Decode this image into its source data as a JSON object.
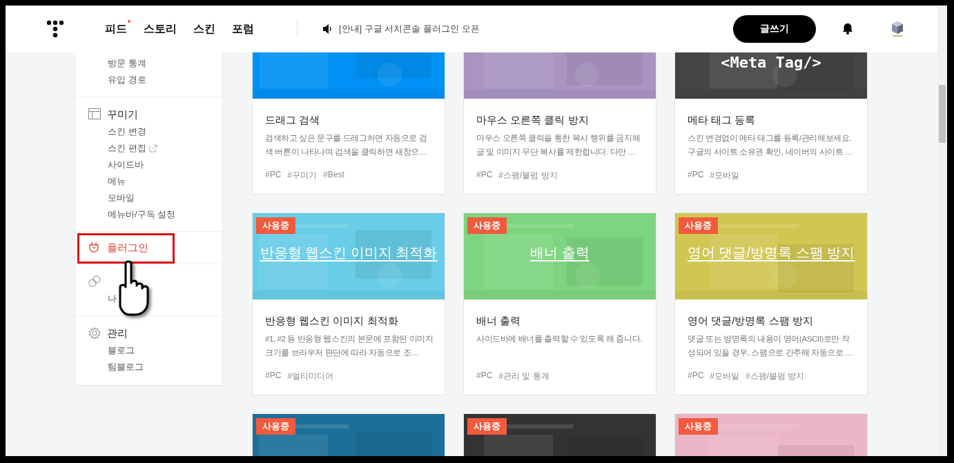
{
  "header": {
    "nav": [
      {
        "label": "피드",
        "new_dot": true
      },
      {
        "label": "스토리",
        "new_dot": false
      },
      {
        "label": "스킨",
        "new_dot": false
      },
      {
        "label": "포럼",
        "new_dot": false
      }
    ],
    "notice": "[안내] 구글 서치콘솔 플러그인 오픈",
    "write_button": "글쓰기"
  },
  "sidebar": {
    "groups": [
      {
        "kind": "list",
        "selected": false,
        "annotated": false,
        "items": [
          {
            "label": "방문 통계",
            "external": false
          },
          {
            "label": "유입 경로",
            "external": false
          }
        ]
      },
      {
        "kind": "layout",
        "title": "꾸미기",
        "selected": false,
        "annotated": false,
        "items": [
          {
            "label": "스킨 변경",
            "external": false
          },
          {
            "label": "스킨 편집",
            "external": true
          },
          {
            "label": "사이드바",
            "external": false
          },
          {
            "label": "메뉴",
            "external": false
          },
          {
            "label": "모바일",
            "external": false
          },
          {
            "label": "메뉴바/구독 설정",
            "external": false
          }
        ]
      },
      {
        "kind": "plug",
        "title": "플러그인",
        "selected": true,
        "annotated": true
      },
      {
        "kind": "link",
        "selected": false,
        "annotated": false,
        "items": [
          {
            "label": "나",
            "external": false
          }
        ]
      },
      {
        "kind": "gear",
        "title": "관리",
        "selected": false,
        "annotated": false,
        "items": [
          {
            "label": "블로그",
            "external": false
          },
          {
            "label": "팀블로그",
            "external": false
          }
        ]
      }
    ]
  },
  "plugin_rows": [
    {
      "plugins": [
        {
          "kind": "picture",
          "color": "#0091f4",
          "name": "드래그 검색",
          "description": "검색하고 싶은 문구를 드래그하면 자동으로 검색 버튼이 나타나며 검색을 클릭하면 새창으…",
          "tags": [
            "#PC",
            "#꾸미기",
            "#Best"
          ]
        },
        {
          "kind": "picture",
          "color": "#a994c2",
          "name": "마우스 오른쪽 클릭 방지",
          "description": "마우스 오른쪽 클릭을 통한 복사 행위를 금지해 글 및 이미지 무단 복사를 제한합니다. 다만 …",
          "tags": [
            "#PC",
            "#스팸/블펌 방지"
          ]
        },
        {
          "kind": "code",
          "banner": "<Meta Tag/>",
          "color": "#444444",
          "name": "메타 태그 등록",
          "description": "스킨 변경없이 메타 태그를 등록/관리해보세요. 구글의 사이트 소유권 확인, 네이버의 사이트 …",
          "tags": [
            "#PC",
            "#모바일"
          ]
        }
      ]
    },
    {
      "plugins": [
        {
          "kind": "text",
          "banner": "반응형 웹스킨 이미지 최적화",
          "badge": "사용중",
          "color": "#68cde6",
          "name": "반응형 웹스킨 이미지 최적화",
          "description": "#1, #2 등 반응형 웹스킨의 본문에 포함된 이미지 크기를 브라우저 판단에 따라 자동으로 조…",
          "tags": [
            "#PC",
            "#멀티미디어"
          ]
        },
        {
          "kind": "text",
          "banner": "배너 출력",
          "badge": "사용중",
          "color": "#7dd57f",
          "name": "배너 출력",
          "description": "사이드바에 배너를 출력할 수 있도록 해 줍니다.",
          "tags": [
            "#PC",
            "#관리 및 통계"
          ]
        },
        {
          "kind": "text",
          "banner": "영어 댓글/방명록 스팸 방지",
          "badge": "사용중",
          "color": "#d1c652",
          "name": "영어 댓글/방명록 스팸 방지",
          "description": "댓글 또는 방명록의 내용이 영어(ASCII)로만 작성되어 있을 경우, 스팸으로 간주해 자동으로 …",
          "tags": [
            "#PC",
            "#모바일",
            "#스팸/블펌 방지"
          ]
        }
      ]
    },
    {
      "plugins": [
        {
          "kind": "picture",
          "badge": "사용중",
          "color": "#1b6f98"
        },
        {
          "kind": "picture",
          "badge": "사용중",
          "color": "#333333"
        },
        {
          "kind": "picture",
          "badge": "사용중",
          "color": "#ebb6c9"
        }
      ]
    }
  ]
}
